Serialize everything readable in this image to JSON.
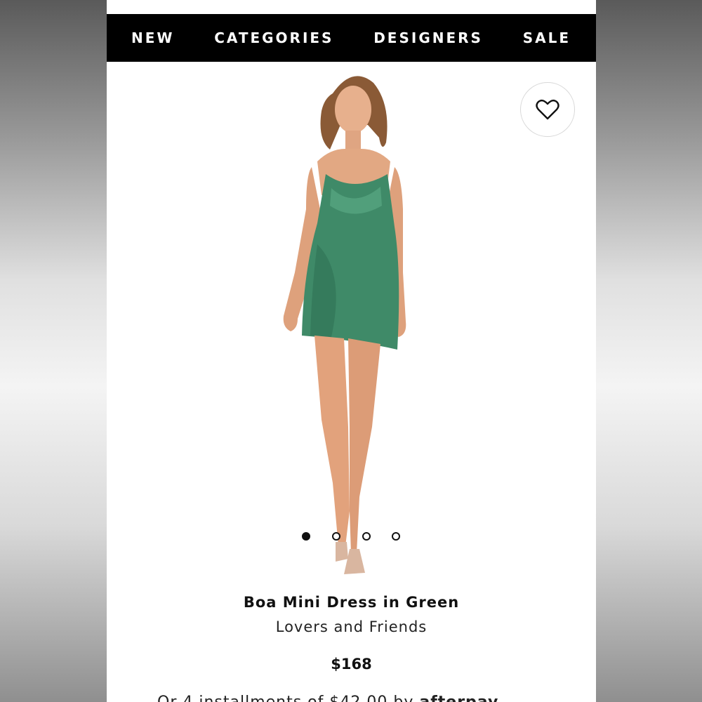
{
  "nav": {
    "items": [
      "NEW",
      "CATEGORIES",
      "DESIGNERS",
      "SALE"
    ]
  },
  "product": {
    "image": "model wearing green satin cowl-neck mini dress",
    "dress_color": "#3f8a68",
    "wishlist_icon": "heart-outline-icon",
    "carousel": {
      "total": 4,
      "active": 1
    },
    "title": "Boa Mini Dress in Green",
    "brand": "Lovers and Friends",
    "price": "$168",
    "installments_text": "Or 4 installments of $42.00 by",
    "installments_provider": "afterpay"
  }
}
